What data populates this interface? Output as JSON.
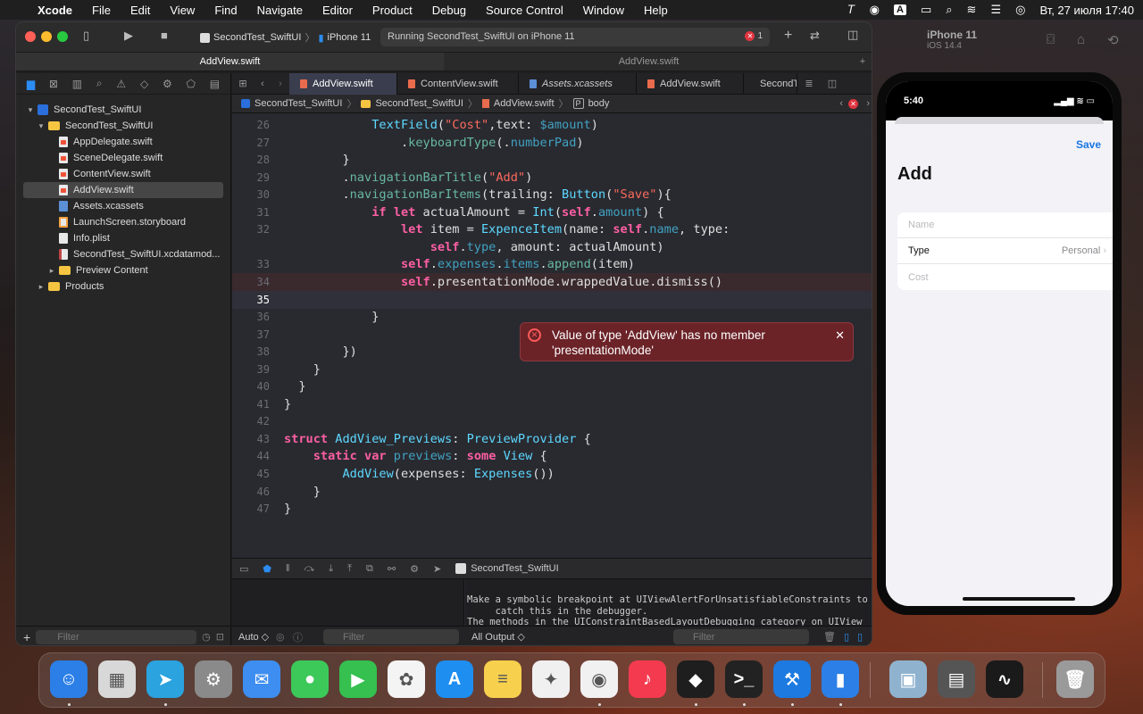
{
  "menubar": {
    "app": "Xcode",
    "items": [
      "File",
      "Edit",
      "View",
      "Find",
      "Navigate",
      "Editor",
      "Product",
      "Debug",
      "Source Control",
      "Window",
      "Help"
    ],
    "keyboard": "A",
    "datetime": "Вт, 27 июля  17:40"
  },
  "toolbar": {
    "scheme": "SecondTest_SwiftUI",
    "device": "iPhone 11",
    "status": "Running SecondTest_SwiftUI on iPhone 11",
    "error_count": "1"
  },
  "window_tabs": [
    "AddView.swift",
    "AddView.swift"
  ],
  "navigator": {
    "project": "SecondTest_SwiftUI",
    "group": "SecondTest_SwiftUI",
    "files": [
      "AppDelegate.swift",
      "SceneDelegate.swift",
      "ContentView.swift",
      "AddView.swift",
      "Assets.xcassets",
      "LaunchScreen.storyboard",
      "Info.plist",
      "SecondTest_SwiftUI.xcdatamod...",
      "Preview Content"
    ],
    "products": "Products",
    "filter_placeholder": "Filter"
  },
  "editor_tabs": [
    "AddView.swift",
    "ContentView.swift",
    "Assets.xcassets",
    "AddView.swift",
    "SecondT"
  ],
  "jumpbar": [
    "SecondTest_SwiftUI",
    "SecondTest_SwiftUI",
    "AddView.swift",
    "body"
  ],
  "code_lines": [
    {
      "n": "26",
      "segs": [
        {
          "t": "            "
        },
        {
          "t": "TextField",
          "c": "ty"
        },
        {
          "t": "("
        },
        {
          "t": "\"Cost\"",
          "c": "str"
        },
        {
          "t": ",text: "
        },
        {
          "t": "$amount",
          "c": "prop"
        },
        {
          "t": ")"
        }
      ]
    },
    {
      "n": "27",
      "segs": [
        {
          "t": "                ."
        },
        {
          "t": "keyboardType",
          "c": "fn"
        },
        {
          "t": "(."
        },
        {
          "t": "numberPad",
          "c": "prop"
        },
        {
          "t": ")"
        }
      ]
    },
    {
      "n": "28",
      "segs": [
        {
          "t": "        }"
        }
      ]
    },
    {
      "n": "29",
      "segs": [
        {
          "t": "        ."
        },
        {
          "t": "navigationBarTitle",
          "c": "fn"
        },
        {
          "t": "("
        },
        {
          "t": "\"Add\"",
          "c": "str"
        },
        {
          "t": ")"
        }
      ]
    },
    {
      "n": "30",
      "segs": [
        {
          "t": "        ."
        },
        {
          "t": "navigationBarItems",
          "c": "fn"
        },
        {
          "t": "(trailing: "
        },
        {
          "t": "Button",
          "c": "ty"
        },
        {
          "t": "("
        },
        {
          "t": "\"Save\"",
          "c": "str"
        },
        {
          "t": "){"
        }
      ]
    },
    {
      "n": "31",
      "segs": [
        {
          "t": "            "
        },
        {
          "t": "if let",
          "c": "kw"
        },
        {
          "t": " actualAmount = "
        },
        {
          "t": "Int",
          "c": "ty"
        },
        {
          "t": "("
        },
        {
          "t": "self",
          "c": "kw"
        },
        {
          "t": "."
        },
        {
          "t": "amount",
          "c": "prop"
        },
        {
          "t": ") {"
        }
      ]
    },
    {
      "n": "32",
      "segs": [
        {
          "t": "                "
        },
        {
          "t": "let",
          "c": "kw"
        },
        {
          "t": " item = "
        },
        {
          "t": "ExpenceItem",
          "c": "ty"
        },
        {
          "t": "(name: "
        },
        {
          "t": "self",
          "c": "kw"
        },
        {
          "t": "."
        },
        {
          "t": "name",
          "c": "prop"
        },
        {
          "t": ", type:"
        }
      ]
    },
    {
      "n": "",
      "segs": [
        {
          "t": "                    "
        },
        {
          "t": "self",
          "c": "kw"
        },
        {
          "t": "."
        },
        {
          "t": "type",
          "c": "prop"
        },
        {
          "t": ", amount: actualAmount)"
        }
      ]
    },
    {
      "n": "33",
      "segs": [
        {
          "t": "                "
        },
        {
          "t": "self",
          "c": "kw"
        },
        {
          "t": "."
        },
        {
          "t": "expenses",
          "c": "prop"
        },
        {
          "t": "."
        },
        {
          "t": "items",
          "c": "prop"
        },
        {
          "t": "."
        },
        {
          "t": "append",
          "c": "fn"
        },
        {
          "t": "(item)"
        }
      ]
    },
    {
      "n": "34",
      "segs": [
        {
          "t": "                "
        },
        {
          "t": "self",
          "c": "kw"
        },
        {
          "t": ".presentationMode.wrappedValue.dismiss()"
        }
      ],
      "err": true
    },
    {
      "n": "35",
      "segs": [
        {
          "t": ""
        }
      ],
      "cur": true
    },
    {
      "n": "36",
      "segs": [
        {
          "t": "            }"
        }
      ]
    },
    {
      "n": "37",
      "segs": [
        {
          "t": ""
        }
      ]
    },
    {
      "n": "38",
      "segs": [
        {
          "t": "        })"
        }
      ]
    },
    {
      "n": "39",
      "segs": [
        {
          "t": "    }"
        }
      ]
    },
    {
      "n": "40",
      "segs": [
        {
          "t": "  }"
        }
      ]
    },
    {
      "n": "41",
      "segs": [
        {
          "t": "}"
        }
      ]
    },
    {
      "n": "42",
      "segs": [
        {
          "t": ""
        }
      ]
    },
    {
      "n": "43",
      "segs": [
        {
          "t": "struct",
          "c": "kw"
        },
        {
          "t": " "
        },
        {
          "t": "AddView_Previews",
          "c": "ty"
        },
        {
          "t": ": "
        },
        {
          "t": "PreviewProvider",
          "c": "ty"
        },
        {
          "t": " {"
        }
      ]
    },
    {
      "n": "44",
      "segs": [
        {
          "t": "    "
        },
        {
          "t": "static var",
          "c": "kw"
        },
        {
          "t": " "
        },
        {
          "t": "previews",
          "c": "prop"
        },
        {
          "t": ": "
        },
        {
          "t": "some",
          "c": "kw"
        },
        {
          "t": " "
        },
        {
          "t": "View",
          "c": "ty"
        },
        {
          "t": " {"
        }
      ]
    },
    {
      "n": "45",
      "segs": [
        {
          "t": "        "
        },
        {
          "t": "AddView",
          "c": "ty"
        },
        {
          "t": "(expenses: "
        },
        {
          "t": "Expenses",
          "c": "ty"
        },
        {
          "t": "())"
        }
      ]
    },
    {
      "n": "46",
      "segs": [
        {
          "t": "    }"
        }
      ]
    },
    {
      "n": "47",
      "segs": [
        {
          "t": "}"
        }
      ]
    }
  ],
  "error_popup": "Value of type 'AddView' has no member 'presentationMode'",
  "debug": {
    "target": "SecondTest_SwiftUI",
    "console": "Make a symbolic breakpoint at UIViewAlertForUnsatisfiableConstraints to\n     catch this in the debugger.\nThe methods in the UIConstraintBasedLayoutDebugging category on UIView\n     listed in <UIKitCore/UIView.h> may also be helpful.",
    "auto": "Auto ◇",
    "filter": "Filter",
    "all_output": "All Output ◇"
  },
  "simulator": {
    "device": "iPhone 11",
    "os": "iOS 14.4",
    "time": "5:40",
    "save": "Save",
    "title": "Add",
    "rows": [
      {
        "label": "Name",
        "placeholder": true
      },
      {
        "label": "Type",
        "value": "Personal"
      },
      {
        "label": "Cost",
        "placeholder": true
      }
    ]
  },
  "dock": [
    {
      "name": "finder",
      "color": "#2b7fe6",
      "glyph": "☺",
      "dot": true
    },
    {
      "name": "launchpad",
      "color": "#d8d8d8",
      "glyph": "▦"
    },
    {
      "name": "telegram",
      "color": "#2aa3df",
      "glyph": "➤",
      "dot": true
    },
    {
      "name": "system-preferences",
      "color": "#8a8a8a",
      "glyph": "⚙"
    },
    {
      "name": "mail",
      "color": "#3d8ef0",
      "glyph": "✉"
    },
    {
      "name": "messages",
      "color": "#3dc95a",
      "glyph": "●"
    },
    {
      "name": "facetime",
      "color": "#35c04f",
      "glyph": "▶"
    },
    {
      "name": "photos",
      "color": "#f4f4f4",
      "glyph": "✿"
    },
    {
      "name": "app-store",
      "color": "#1e8ef0",
      "glyph": "A"
    },
    {
      "name": "notes",
      "color": "#f7d04d",
      "glyph": "≡"
    },
    {
      "name": "safari",
      "color": "#f0f0f0",
      "glyph": "✦"
    },
    {
      "name": "chrome",
      "color": "#f1f1f1",
      "glyph": "◉",
      "dot": true
    },
    {
      "name": "music",
      "color": "#f43a4f",
      "glyph": "♪"
    },
    {
      "name": "figma",
      "color": "#1e1e1e",
      "glyph": "◆",
      "dot": true
    },
    {
      "name": "terminal",
      "color": "#222",
      "glyph": ">_",
      "dot": true
    },
    {
      "name": "xcode",
      "color": "#1c7ae0",
      "glyph": "⚒",
      "dot": true
    },
    {
      "name": "simulator",
      "color": "#2b7fe6",
      "glyph": "▮",
      "dot": true
    },
    {
      "name": "preview",
      "color": "#8fb3cf",
      "glyph": "▣"
    },
    {
      "name": "calculator",
      "color": "#555",
      "glyph": "▤"
    },
    {
      "name": "activity-monitor",
      "color": "#1a1a1a",
      "glyph": "∿"
    },
    {
      "name": "trash",
      "color": "#9a9a9a",
      "glyph": "🗑"
    }
  ]
}
